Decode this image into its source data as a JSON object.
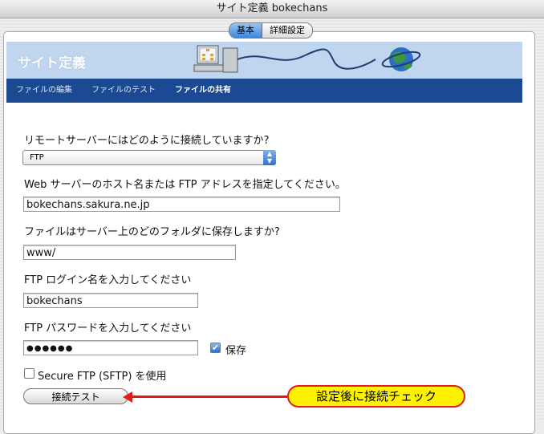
{
  "window": {
    "title": "サイト定義 bokechans"
  },
  "tabs": [
    {
      "label": "基本",
      "active": true
    },
    {
      "label": "詳細設定",
      "active": false
    }
  ],
  "banner": {
    "title": "サイト定義"
  },
  "nav": {
    "items": [
      {
        "label": "ファイルの編集"
      },
      {
        "label": "ファイルのテスト"
      },
      {
        "label": "ファイルの共有",
        "active": true
      }
    ]
  },
  "form": {
    "q_connect": "リモートサーバーにはどのように接続していますか?",
    "connect_value": "FTP",
    "q_host": "Web サーバーのホスト名または FTP アドレスを指定してください。",
    "host_value": "bokechans.sakura.ne.jp",
    "q_folder": "ファイルはサーバー上のどのフォルダに保存しますか?",
    "folder_value": "www/",
    "q_login": "FTP ログイン名を入力してください",
    "login_value": "bokechans",
    "q_password": "FTP パスワードを入力してください",
    "password_value": "●●●●●●",
    "save_label": "保存",
    "save_checked": true,
    "sftp_label": "Secure FTP (SFTP) を使用",
    "sftp_checked": false,
    "test_button": "接続テスト"
  },
  "annotation": {
    "text": "設定後に接続チェック",
    "color": "#e11a1a",
    "fill": "#fff200"
  }
}
